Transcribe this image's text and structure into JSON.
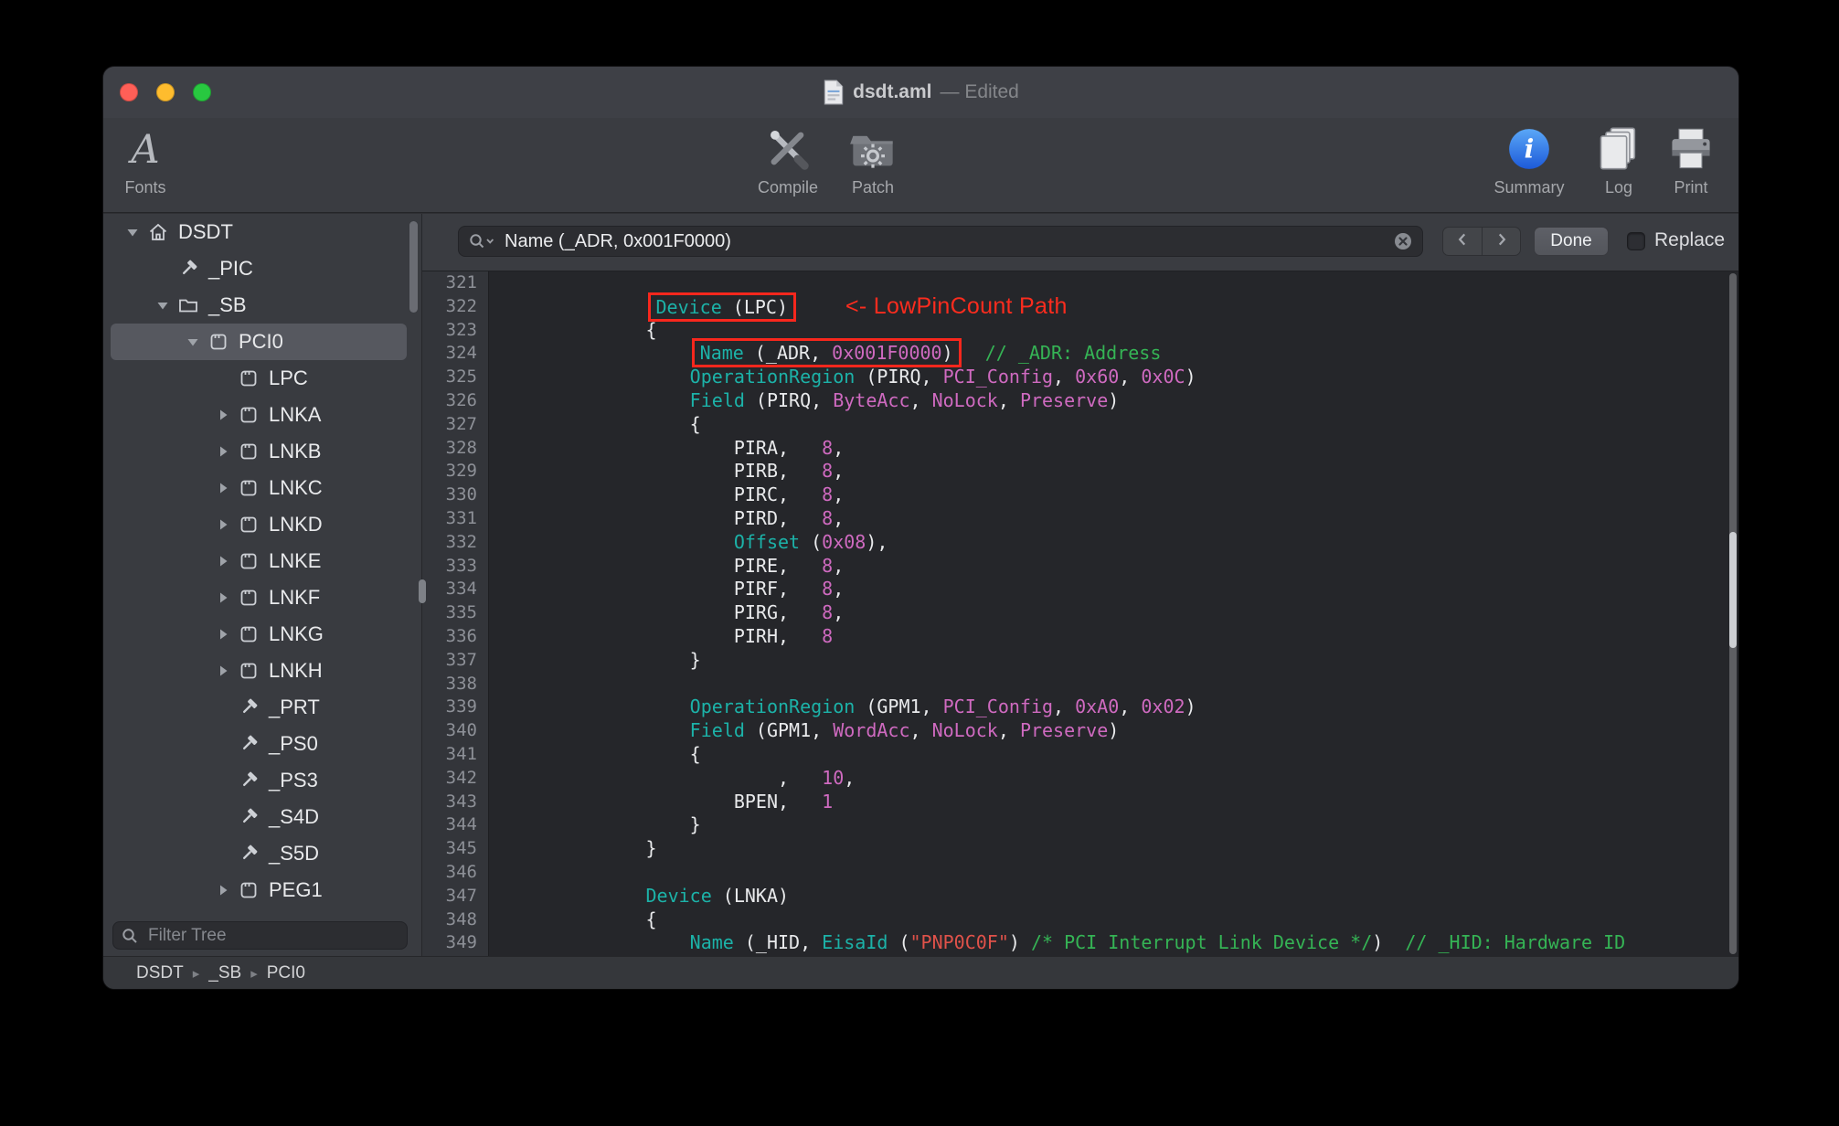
{
  "window": {
    "title": "dsdt.aml",
    "edited_suffix": "— Edited"
  },
  "toolbar": {
    "fonts": {
      "label": "Fonts"
    },
    "compile": {
      "label": "Compile"
    },
    "patch": {
      "label": "Patch"
    },
    "summary": {
      "label": "Summary"
    },
    "log": {
      "label": "Log"
    },
    "print": {
      "label": "Print"
    }
  },
  "sidebar": {
    "filter_placeholder": "Filter Tree",
    "items": [
      {
        "label": "DSDT",
        "icon": "house",
        "depth": 0,
        "disclosure": "open"
      },
      {
        "label": "_PIC",
        "icon": "method",
        "depth": 1
      },
      {
        "label": "_SB",
        "icon": "folder",
        "depth": 1,
        "disclosure": "open"
      },
      {
        "label": "PCI0",
        "icon": "device",
        "depth": 2,
        "disclosure": "open",
        "selected": true
      },
      {
        "label": "LPC",
        "icon": "device",
        "depth": 3
      },
      {
        "label": "LNKA",
        "icon": "device",
        "depth": 3,
        "disclosure": "closed"
      },
      {
        "label": "LNKB",
        "icon": "device",
        "depth": 3,
        "disclosure": "closed"
      },
      {
        "label": "LNKC",
        "icon": "device",
        "depth": 3,
        "disclosure": "closed"
      },
      {
        "label": "LNKD",
        "icon": "device",
        "depth": 3,
        "disclosure": "closed"
      },
      {
        "label": "LNKE",
        "icon": "device",
        "depth": 3,
        "disclosure": "closed"
      },
      {
        "label": "LNKF",
        "icon": "device",
        "depth": 3,
        "disclosure": "closed"
      },
      {
        "label": "LNKG",
        "icon": "device",
        "depth": 3,
        "disclosure": "closed"
      },
      {
        "label": "LNKH",
        "icon": "device",
        "depth": 3,
        "disclosure": "closed"
      },
      {
        "label": "_PRT",
        "icon": "method",
        "depth": 3
      },
      {
        "label": "_PS0",
        "icon": "method",
        "depth": 3
      },
      {
        "label": "_PS3",
        "icon": "method",
        "depth": 3
      },
      {
        "label": "_S4D",
        "icon": "method",
        "depth": 3
      },
      {
        "label": "_S5D",
        "icon": "method",
        "depth": 3
      },
      {
        "label": "PEG1",
        "icon": "device",
        "depth": 3,
        "disclosure": "closed"
      }
    ]
  },
  "findbar": {
    "query": "Name (_ADR, 0x001F0000)",
    "done_label": "Done",
    "replace_label": "Replace"
  },
  "statusbar": {
    "path": [
      "DSDT",
      "_SB",
      "PCI0"
    ],
    "separator": "▸"
  },
  "editor": {
    "lines": [
      {
        "n": 321,
        "seg": []
      },
      {
        "n": 322,
        "seg": [
          {
            "c": "p",
            "t": "            "
          },
          {
            "c": "k",
            "t": "Device",
            "b": 1
          },
          {
            "c": "p",
            "t": " (LPC)",
            "b": 1
          },
          {
            "c": "note",
            "t": "<- LowPinCount Path"
          }
        ]
      },
      {
        "n": 323,
        "seg": [
          {
            "c": "p",
            "t": "            {"
          }
        ]
      },
      {
        "n": 324,
        "seg": [
          {
            "c": "p",
            "t": "                "
          },
          {
            "c": "k",
            "t": "Name",
            "b": 1
          },
          {
            "c": "p",
            "t": " (_ADR, ",
            "b": 1
          },
          {
            "c": "n",
            "t": "0x001F0000",
            "b": 1
          },
          {
            "c": "p",
            "t": ")",
            "b": 1
          },
          {
            "c": "p",
            "t": "  "
          },
          {
            "c": "c",
            "t": "// _ADR: Address"
          }
        ]
      },
      {
        "n": 325,
        "seg": [
          {
            "c": "p",
            "t": "                "
          },
          {
            "c": "k",
            "t": "OperationRegion"
          },
          {
            "c": "p",
            "t": " (PIRQ, "
          },
          {
            "c": "n",
            "t": "PCI_Config"
          },
          {
            "c": "p",
            "t": ", "
          },
          {
            "c": "n",
            "t": "0x60"
          },
          {
            "c": "p",
            "t": ", "
          },
          {
            "c": "n",
            "t": "0x0C"
          },
          {
            "c": "p",
            "t": ")"
          }
        ]
      },
      {
        "n": 326,
        "seg": [
          {
            "c": "p",
            "t": "                "
          },
          {
            "c": "k",
            "t": "Field"
          },
          {
            "c": "p",
            "t": " (PIRQ, "
          },
          {
            "c": "n",
            "t": "ByteAcc"
          },
          {
            "c": "p",
            "t": ", "
          },
          {
            "c": "n",
            "t": "NoLock"
          },
          {
            "c": "p",
            "t": ", "
          },
          {
            "c": "n",
            "t": "Preserve"
          },
          {
            "c": "p",
            "t": ")"
          }
        ]
      },
      {
        "n": 327,
        "seg": [
          {
            "c": "p",
            "t": "                {"
          }
        ]
      },
      {
        "n": 328,
        "seg": [
          {
            "c": "p",
            "t": "                    PIRA,   "
          },
          {
            "c": "n",
            "t": "8"
          },
          {
            "c": "p",
            "t": ","
          }
        ]
      },
      {
        "n": 329,
        "seg": [
          {
            "c": "p",
            "t": "                    PIRB,   "
          },
          {
            "c": "n",
            "t": "8"
          },
          {
            "c": "p",
            "t": ","
          }
        ]
      },
      {
        "n": 330,
        "seg": [
          {
            "c": "p",
            "t": "                    PIRC,   "
          },
          {
            "c": "n",
            "t": "8"
          },
          {
            "c": "p",
            "t": ","
          }
        ]
      },
      {
        "n": 331,
        "seg": [
          {
            "c": "p",
            "t": "                    PIRD,   "
          },
          {
            "c": "n",
            "t": "8"
          },
          {
            "c": "p",
            "t": ","
          }
        ]
      },
      {
        "n": 332,
        "seg": [
          {
            "c": "p",
            "t": "                    "
          },
          {
            "c": "k",
            "t": "Offset"
          },
          {
            "c": "p",
            "t": " ("
          },
          {
            "c": "n",
            "t": "0x08"
          },
          {
            "c": "p",
            "t": "),"
          }
        ]
      },
      {
        "n": 333,
        "seg": [
          {
            "c": "p",
            "t": "                    PIRE,   "
          },
          {
            "c": "n",
            "t": "8"
          },
          {
            "c": "p",
            "t": ","
          }
        ]
      },
      {
        "n": 334,
        "seg": [
          {
            "c": "p",
            "t": "                    PIRF,   "
          },
          {
            "c": "n",
            "t": "8"
          },
          {
            "c": "p",
            "t": ","
          }
        ]
      },
      {
        "n": 335,
        "seg": [
          {
            "c": "p",
            "t": "                    PIRG,   "
          },
          {
            "c": "n",
            "t": "8"
          },
          {
            "c": "p",
            "t": ","
          }
        ]
      },
      {
        "n": 336,
        "seg": [
          {
            "c": "p",
            "t": "                    PIRH,   "
          },
          {
            "c": "n",
            "t": "8"
          }
        ]
      },
      {
        "n": 337,
        "seg": [
          {
            "c": "p",
            "t": "                }"
          }
        ]
      },
      {
        "n": 338,
        "seg": []
      },
      {
        "n": 339,
        "seg": [
          {
            "c": "p",
            "t": "                "
          },
          {
            "c": "k",
            "t": "OperationRegion"
          },
          {
            "c": "p",
            "t": " (GPM1, "
          },
          {
            "c": "n",
            "t": "PCI_Config"
          },
          {
            "c": "p",
            "t": ", "
          },
          {
            "c": "n",
            "t": "0xA0"
          },
          {
            "c": "p",
            "t": ", "
          },
          {
            "c": "n",
            "t": "0x02"
          },
          {
            "c": "p",
            "t": ")"
          }
        ]
      },
      {
        "n": 340,
        "seg": [
          {
            "c": "p",
            "t": "                "
          },
          {
            "c": "k",
            "t": "Field"
          },
          {
            "c": "p",
            "t": " (GPM1, "
          },
          {
            "c": "n",
            "t": "WordAcc"
          },
          {
            "c": "p",
            "t": ", "
          },
          {
            "c": "n",
            "t": "NoLock"
          },
          {
            "c": "p",
            "t": ", "
          },
          {
            "c": "n",
            "t": "Preserve"
          },
          {
            "c": "p",
            "t": ")"
          }
        ]
      },
      {
        "n": 341,
        "seg": [
          {
            "c": "p",
            "t": "                {"
          }
        ]
      },
      {
        "n": 342,
        "seg": [
          {
            "c": "p",
            "t": "                        ,   "
          },
          {
            "c": "n",
            "t": "10"
          },
          {
            "c": "p",
            "t": ","
          }
        ]
      },
      {
        "n": 343,
        "seg": [
          {
            "c": "p",
            "t": "                    BPEN,   "
          },
          {
            "c": "n",
            "t": "1"
          }
        ]
      },
      {
        "n": 344,
        "seg": [
          {
            "c": "p",
            "t": "                }"
          }
        ]
      },
      {
        "n": 345,
        "seg": [
          {
            "c": "p",
            "t": "            }"
          }
        ]
      },
      {
        "n": 346,
        "seg": []
      },
      {
        "n": 347,
        "seg": [
          {
            "c": "p",
            "t": "            "
          },
          {
            "c": "k",
            "t": "Device"
          },
          {
            "c": "p",
            "t": " (LNKA)"
          }
        ]
      },
      {
        "n": 348,
        "seg": [
          {
            "c": "p",
            "t": "            {"
          }
        ]
      },
      {
        "n": 349,
        "seg": [
          {
            "c": "p",
            "t": "                "
          },
          {
            "c": "k",
            "t": "Name"
          },
          {
            "c": "p",
            "t": " (_HID, "
          },
          {
            "c": "k",
            "t": "EisaId"
          },
          {
            "c": "p",
            "t": " ("
          },
          {
            "c": "s",
            "t": "\"PNP0C0F\""
          },
          {
            "c": "p",
            "t": ") "
          },
          {
            "c": "c",
            "t": "/* PCI Interrupt Link Device */"
          },
          {
            "c": "p",
            "t": ")  "
          },
          {
            "c": "c",
            "t": "// _HID: Hardware ID"
          }
        ]
      }
    ]
  },
  "colors": {
    "keyword": "#1cb2a8",
    "predefined_and_numbers": "#cf6ac0",
    "comment": "#35b455",
    "string": "#e0524a",
    "annotation_red": "#f8271d",
    "selection_row": "#56585f",
    "editor_bg": "#25262a"
  }
}
